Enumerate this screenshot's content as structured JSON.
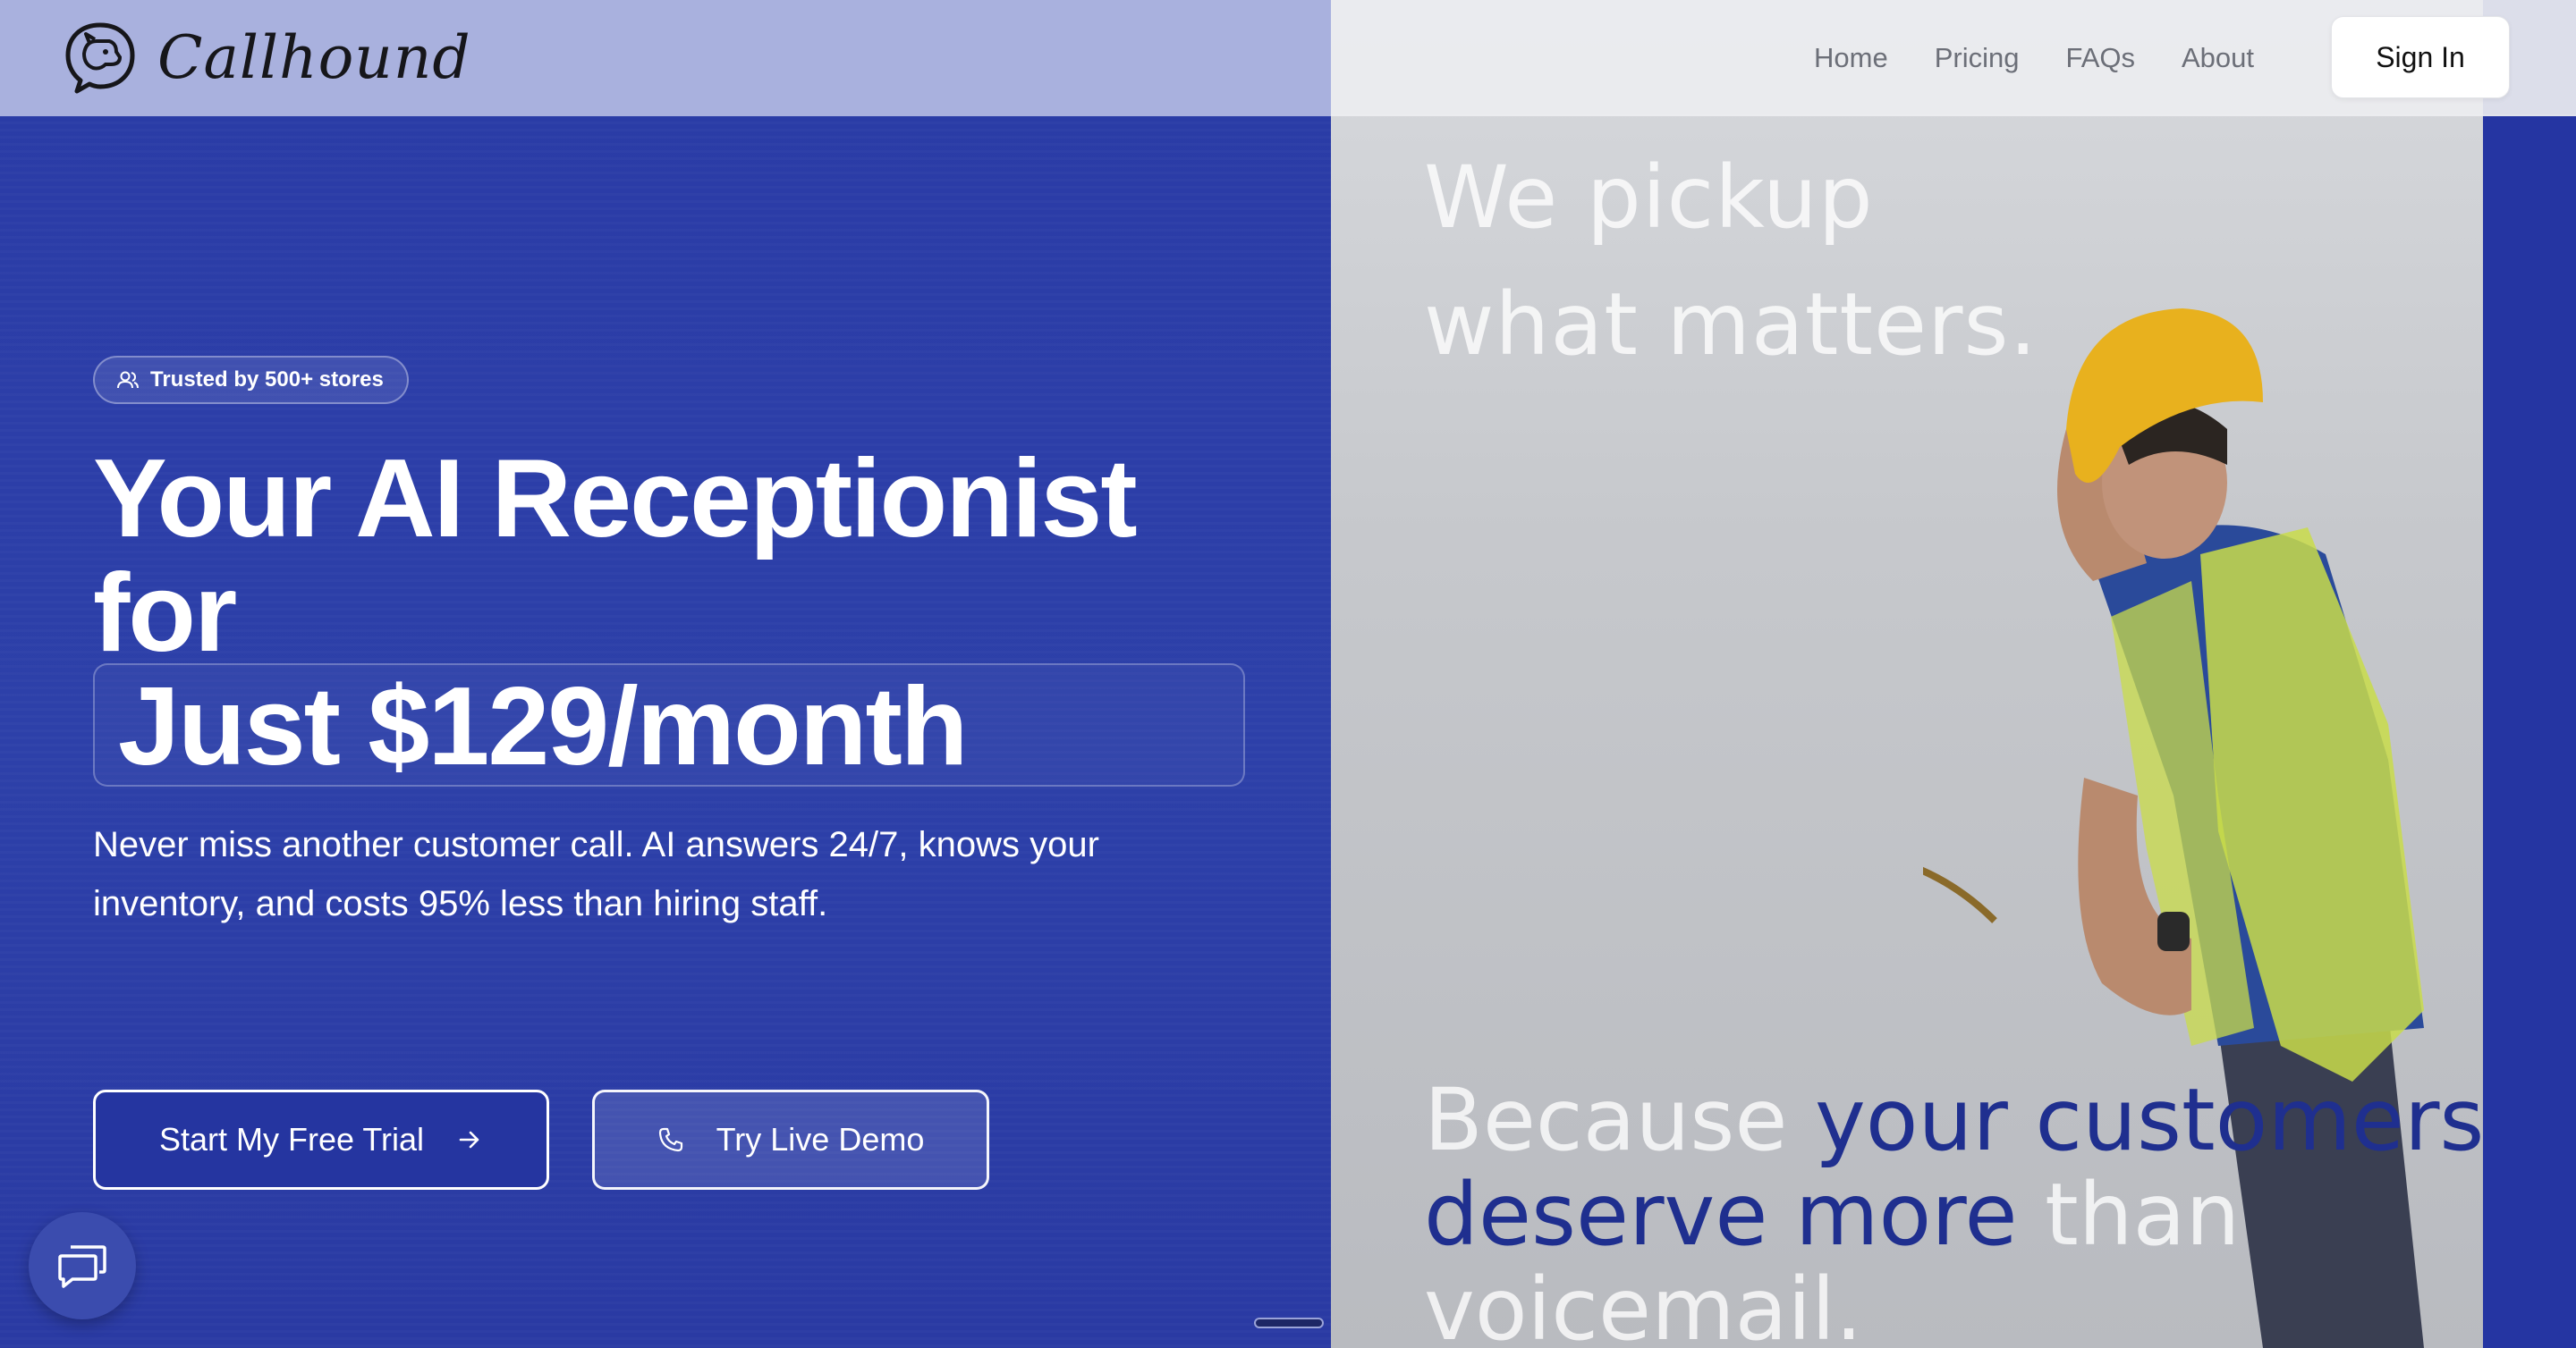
{
  "brand": {
    "name": "Callhound"
  },
  "nav": {
    "links": [
      "Home",
      "Pricing",
      "FAQs",
      "About"
    ],
    "sign_in": "Sign In"
  },
  "hero": {
    "badge": "Trusted by 500+ stores",
    "headline_line1": "Your AI Receptionist",
    "headline_line2": "for",
    "price": "Just $129/month",
    "subtitle": "Never miss another customer call. AI answers 24/7, knows your inventory, and costs 95% less than hiring staff.",
    "primary_cta": "Start My Free Trial",
    "secondary_cta": "Try Live Demo"
  },
  "image_panel": {
    "tagline_line1": "We pickup",
    "tagline_line2": "what matters.",
    "quote_part1": "Because ",
    "quote_highlight1": "your customers",
    "quote_highlight2": "deserve more",
    "quote_part2": " than",
    "quote_part3": "voicemail."
  },
  "colors": {
    "hero_bg": "#2b3ca8",
    "accent_dark": "#1f2f8f",
    "nav_left": "#a9b1de",
    "nav_right": "#ecedf0"
  },
  "icons": {
    "logo": "dog-chat-bubble-icon",
    "badge": "users-icon",
    "trial": "arrow-right-icon",
    "demo": "phone-icon",
    "chat": "chat-bubbles-icon"
  }
}
